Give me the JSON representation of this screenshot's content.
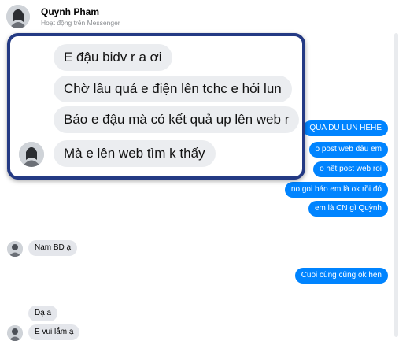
{
  "header": {
    "name": "Quynh Pham",
    "status": "Hoạt động trên Messenger"
  },
  "outgoing": [
    "QUA DU LUN HEHE",
    "o post web đâu em",
    "o hết post web roi",
    "no goi báo em là ok rồi đó",
    "em là CN gì Quỳnh",
    "Cuoi cùng cũng ok hen"
  ],
  "incoming": [
    "Nam BD ạ",
    "Dạ a",
    "E vui lắm ạ"
  ],
  "zoomed": [
    "E đậu bidv r a ơi",
    "Chờ lâu quá e điện lên tchc e hỏi lun",
    "Báo e đậu mà có kết quả up lên web r",
    "Mà e lên web tìm k thấy"
  ],
  "colors": {
    "messenger_blue": "#0084ff",
    "incoming_gray": "#e4e6eb",
    "highlight_border": "#243a84"
  }
}
